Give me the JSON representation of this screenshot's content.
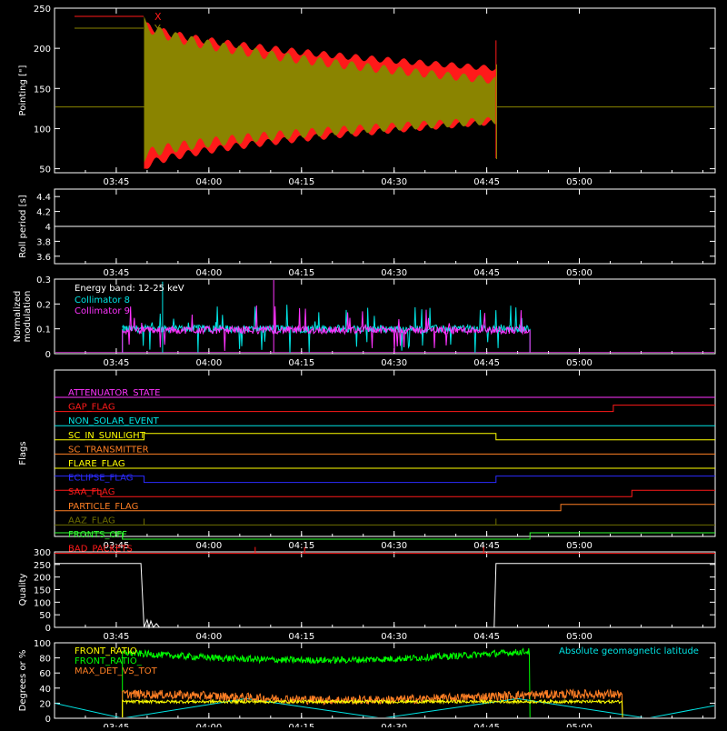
{
  "x_tick_labels": [
    "03:45",
    "04:00",
    "04:15",
    "04:30",
    "04:45",
    "05:00"
  ],
  "x_tick_minutes": [
    225,
    240,
    255,
    270,
    285,
    300
  ],
  "x_range_minutes": [
    215,
    322
  ],
  "x_axis_unit": "time of day (HH:MM), minutes after 00:00",
  "colors": {
    "axis": "#ffffff",
    "red": "#ff1a1a",
    "olive": "#8a8400",
    "cyan": "#00e5e5",
    "magenta": "#ff33ff",
    "green": "#00ff00",
    "orange": "#ff7f24",
    "yellow": "#ffff00",
    "blue": "#2b2bff",
    "dark_green": "#6e6e00",
    "bright_green": "#33ff33"
  },
  "chart_data": [
    {
      "type": "line",
      "ylabel": "Pointing [\"]",
      "ylim": [
        45,
        250
      ],
      "yticks": [
        50,
        100,
        150,
        200,
        250
      ],
      "legend": [
        "X",
        "Y"
      ],
      "series": [
        {
          "name": "X",
          "color": "red",
          "envelope": {
            "start": 229.5,
            "end": 286.5,
            "base": 127,
            "max_start": 232,
            "max_end": 175,
            "min_start": 50,
            "min_end": 108
          }
        },
        {
          "name": "Y",
          "color": "olive",
          "envelope": {
            "start": 229.5,
            "end": 286.5,
            "base": 127,
            "max_start": 233,
            "max_end": 160,
            "min_start": 65,
            "min_end": 110
          }
        }
      ]
    },
    {
      "type": "line",
      "ylabel": "Roll period [s]",
      "ylim": [
        3.5,
        4.5
      ],
      "yticks": [
        3.6,
        3.8,
        4.0,
        4.2,
        4.4
      ],
      "series": [
        {
          "name": "",
          "values": [
            [
              215,
              4.0
            ],
            [
              322,
              4.0
            ]
          ],
          "color": "axis"
        }
      ]
    },
    {
      "type": "line",
      "ylabel": "Normalized modulation",
      "ylim": [
        0,
        0.3
      ],
      "yticks": [
        0.0,
        0.1,
        0.2,
        0.3
      ],
      "annotations": [
        "Energy band: 12-25 keV"
      ],
      "legend": [
        "Collimator 8",
        "Collimator 9"
      ],
      "series": [
        {
          "name": "Collimator 8",
          "color": "cyan",
          "active": [
            226,
            292
          ],
          "level": 0.1
        },
        {
          "name": "Collimator 9",
          "color": "magenta",
          "active": [
            226,
            292
          ],
          "level": 0.095
        }
      ]
    },
    {
      "type": "line",
      "ylabel": "Flags",
      "flags": [
        {
          "name": "ATTENUATOR_STATE",
          "color": "magenta",
          "steps": []
        },
        {
          "name": "GAP_FLAG",
          "color": "red",
          "steps": [
            [
              305.5,
              1
            ]
          ]
        },
        {
          "name": "NON_SOLAR_EVENT",
          "color": "cyan",
          "steps": []
        },
        {
          "name": "SC_IN_SUNLIGHT",
          "color": "yellow",
          "initial": 0,
          "steps": [
            [
              229.5,
              1
            ],
            [
              286.5,
              0
            ]
          ]
        },
        {
          "name": "SC_TRANSMITTER",
          "color": "orange",
          "steps": []
        },
        {
          "name": "FLARE_FLAG",
          "color": "yellow",
          "steps": []
        },
        {
          "name": "ECLIPSE_FLAG",
          "color": "blue",
          "initial": 1,
          "steps": [
            [
              229.5,
              0
            ],
            [
              286.5,
              1
            ]
          ]
        },
        {
          "name": "SAA_FLAG",
          "color": "red",
          "initial": 1,
          "steps": [
            [
              222.5,
              0
            ],
            [
              308.5,
              1
            ]
          ]
        },
        {
          "name": "PARTICLE_FLAG",
          "color": "orange",
          "steps": [
            [
              297,
              1
            ]
          ]
        },
        {
          "name": "AAZ_FLAG",
          "color": "dark_green",
          "spikes": [
            229.5,
            286.5
          ]
        },
        {
          "name": "FRONTS_OFF",
          "color": "bright_green",
          "initial": 1,
          "steps": [
            [
              226,
              0
            ],
            [
              292,
              1
            ]
          ]
        },
        {
          "name": "BAD_PACKETS",
          "color": "red",
          "spikes": [
            247.5,
            255.5,
            284.5
          ]
        }
      ]
    },
    {
      "type": "line",
      "ylabel": "Quality",
      "ylim": [
        0,
        300
      ],
      "yticks": [
        0,
        50,
        100,
        150,
        200,
        250,
        300
      ],
      "series": [
        {
          "name": "",
          "color": "axis",
          "points": [
            [
              215,
              254
            ],
            [
              229,
              254
            ],
            [
              229.5,
              0
            ],
            [
              230,
              30
            ],
            [
              230.3,
              0
            ],
            [
              230.6,
              25
            ],
            [
              231,
              0
            ],
            [
              231.5,
              15
            ],
            [
              232,
              0
            ],
            [
              286.2,
              0
            ],
            [
              286.5,
              254
            ],
            [
              322,
              254
            ]
          ]
        }
      ]
    },
    {
      "type": "line",
      "ylabel": "Degrees or %",
      "ylim": [
        0,
        100
      ],
      "yticks": [
        0,
        20,
        40,
        60,
        80,
        100
      ],
      "legend": [
        "FRONT_RATIO",
        "FRONT_RATIO_",
        "MAX_DET_VS_TOT"
      ],
      "annotations": [
        "Absolute geomagnetic latitude"
      ],
      "series": [
        {
          "name": "FRONT_RATIO",
          "color": "yellow",
          "active": [
            226,
            307
          ],
          "level": 22
        },
        {
          "name": "FRONT_RATIO_",
          "color": "green",
          "active": [
            226,
            292
          ],
          "level": 87
        },
        {
          "name": "MAX_DET_VS_TOT",
          "color": "orange",
          "active": [
            226,
            307
          ],
          "level": 28
        },
        {
          "name": "Absolute geomagnetic latitude",
          "color": "cyan",
          "points": [
            [
              215,
              20
            ],
            [
              226,
              0
            ],
            [
              246,
              26
            ],
            [
              268,
              0
            ],
            [
              290,
              26
            ],
            [
              311,
              0
            ],
            [
              322,
              17
            ]
          ]
        }
      ]
    }
  ]
}
